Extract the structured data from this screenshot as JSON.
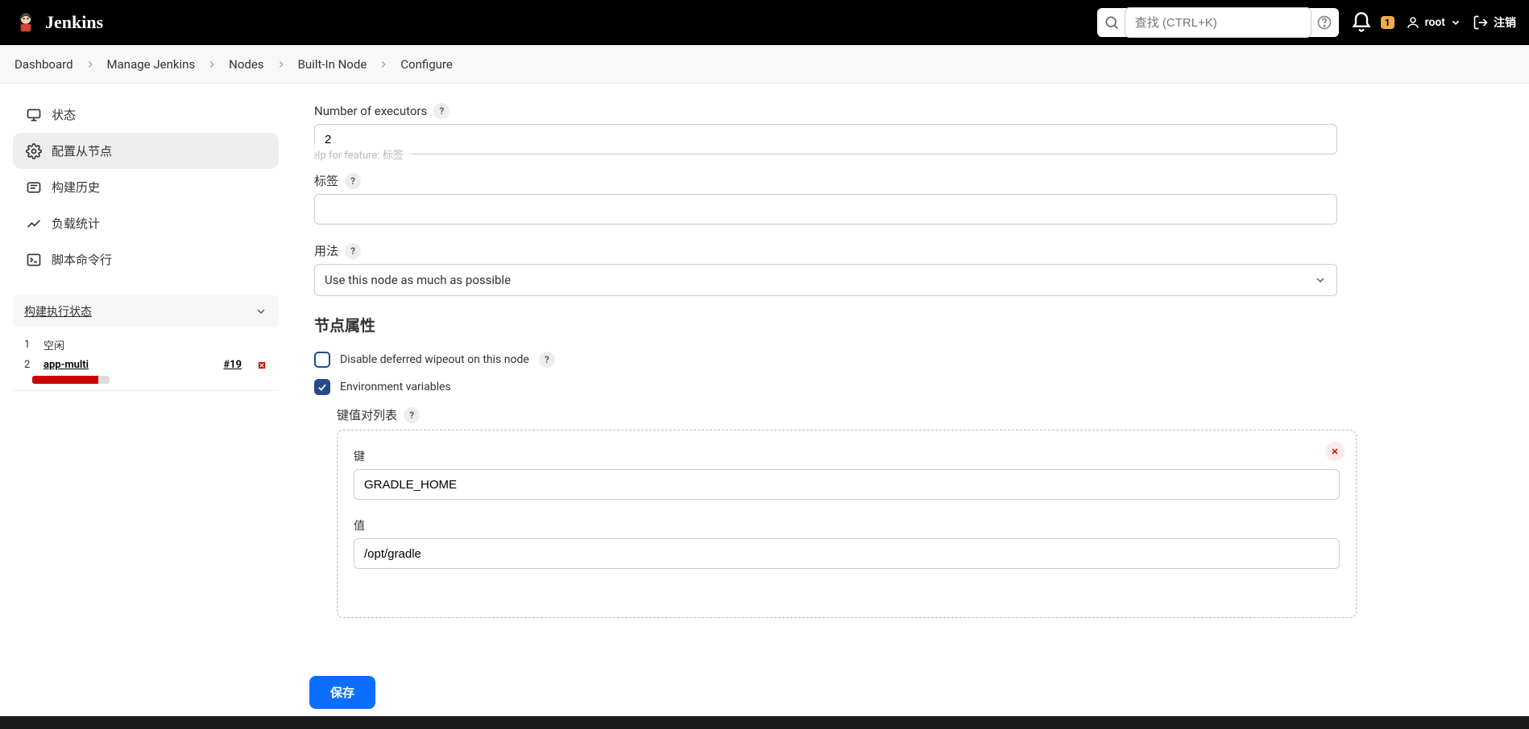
{
  "header": {
    "logo_text": "Jenkins",
    "search_placeholder": "查找 (CTRL+K)",
    "notif_count": "1",
    "user_name": "root",
    "logout_text": "注销"
  },
  "breadcrumbs": [
    "Dashboard",
    "Manage Jenkins",
    "Nodes",
    "Built-In Node",
    "Configure"
  ],
  "sidebar": {
    "items": [
      {
        "label": "状态"
      },
      {
        "label": "配置从节点"
      },
      {
        "label": "构建历史"
      },
      {
        "label": "负载统计"
      },
      {
        "label": "脚本命令行"
      }
    ],
    "executors_title": "构建执行状态",
    "executors": [
      {
        "index": "1",
        "label": "空闲"
      },
      {
        "index": "2",
        "label": "app-multi",
        "build": "#19"
      }
    ]
  },
  "form": {
    "num_executors_label": "Number of executors",
    "num_executors_value": "2",
    "labels_label": "标签",
    "labels_value": "",
    "tooltip_text": "Help for feature: 标签",
    "usage_label": "用法",
    "usage_value": "Use this node as much as possible",
    "section_title": "节点属性",
    "chk_deferred": "Disable deferred wipeout on this node",
    "chk_env": "Environment variables",
    "kv_list_label": "键值对列表",
    "kv_key_label": "键",
    "kv_key_value": "GRADLE_HOME",
    "kv_val_label": "值",
    "kv_val_value": "/opt/gradle",
    "save_label": "保存"
  }
}
